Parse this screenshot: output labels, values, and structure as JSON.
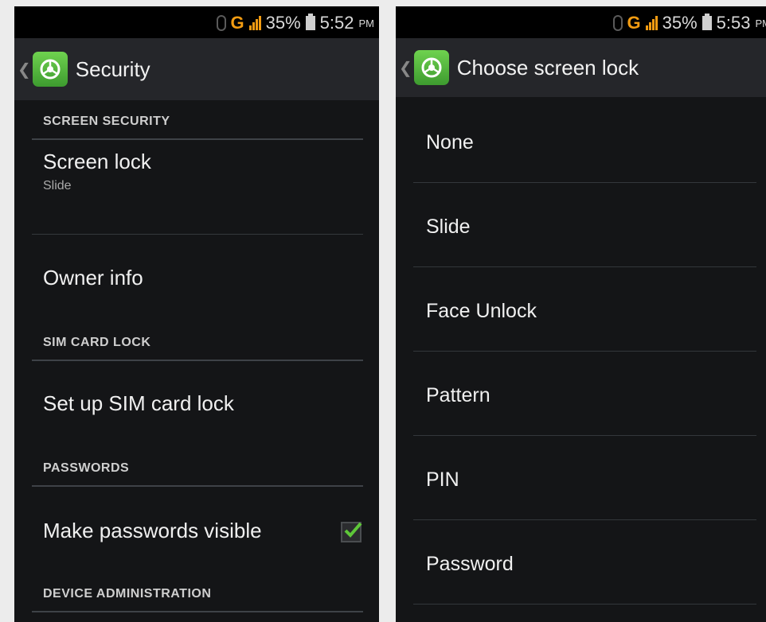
{
  "left_screen": {
    "status": {
      "time": "5:52",
      "ampm": "PM",
      "battery": "35%",
      "network": "G"
    },
    "title": "Security",
    "sections": {
      "screen_security": "SCREEN SECURITY",
      "sim_card_lock": "SIM CARD LOCK",
      "passwords": "PASSWORDS",
      "device_administration": "DEVICE ADMINISTRATION"
    },
    "items": {
      "screen_lock": {
        "title": "Screen lock",
        "summary": "Slide"
      },
      "owner_info": {
        "title": "Owner info"
      },
      "sim_lock": {
        "title": "Set up SIM card lock"
      },
      "passwords_visible": {
        "title": "Make passwords visible",
        "checked": true
      }
    }
  },
  "right_screen": {
    "status": {
      "time": "5:53",
      "ampm": "PM",
      "battery": "35%",
      "network": "G"
    },
    "title": "Choose screen lock",
    "options": [
      "None",
      "Slide",
      "Face Unlock",
      "Pattern",
      "PIN",
      "Password"
    ]
  },
  "colors": {
    "accent": "#6fd24f",
    "status_orange": "#f39c12",
    "checkmark": "#5ec739"
  }
}
